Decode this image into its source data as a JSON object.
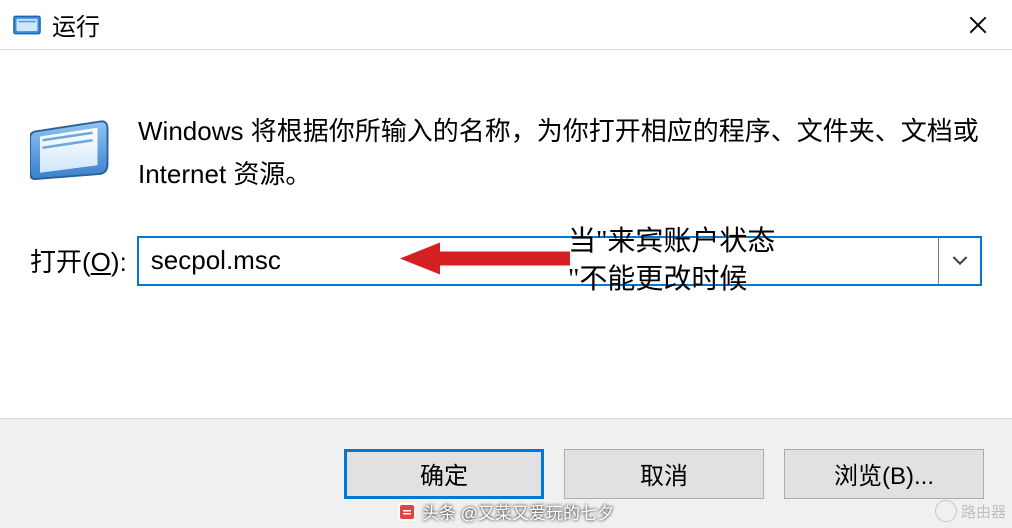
{
  "titlebar": {
    "title": "运行"
  },
  "content": {
    "intro": "Windows 将根据你所输入的名称，为你打开相应的程序、文件夹、文档或 Internet 资源。",
    "open_label_prefix": "打开(",
    "open_label_key": "O",
    "open_label_suffix": "):",
    "input_value": "secpol.msc"
  },
  "annotation": {
    "line1": "当\"来宾账户状态",
    "line2": "\"不能更改时候"
  },
  "buttons": {
    "ok": "确定",
    "cancel": "取消",
    "browse": "浏览(B)..."
  },
  "footer": {
    "credit": "头条 @又菜又爱玩的七夕",
    "watermark": "路由器"
  }
}
